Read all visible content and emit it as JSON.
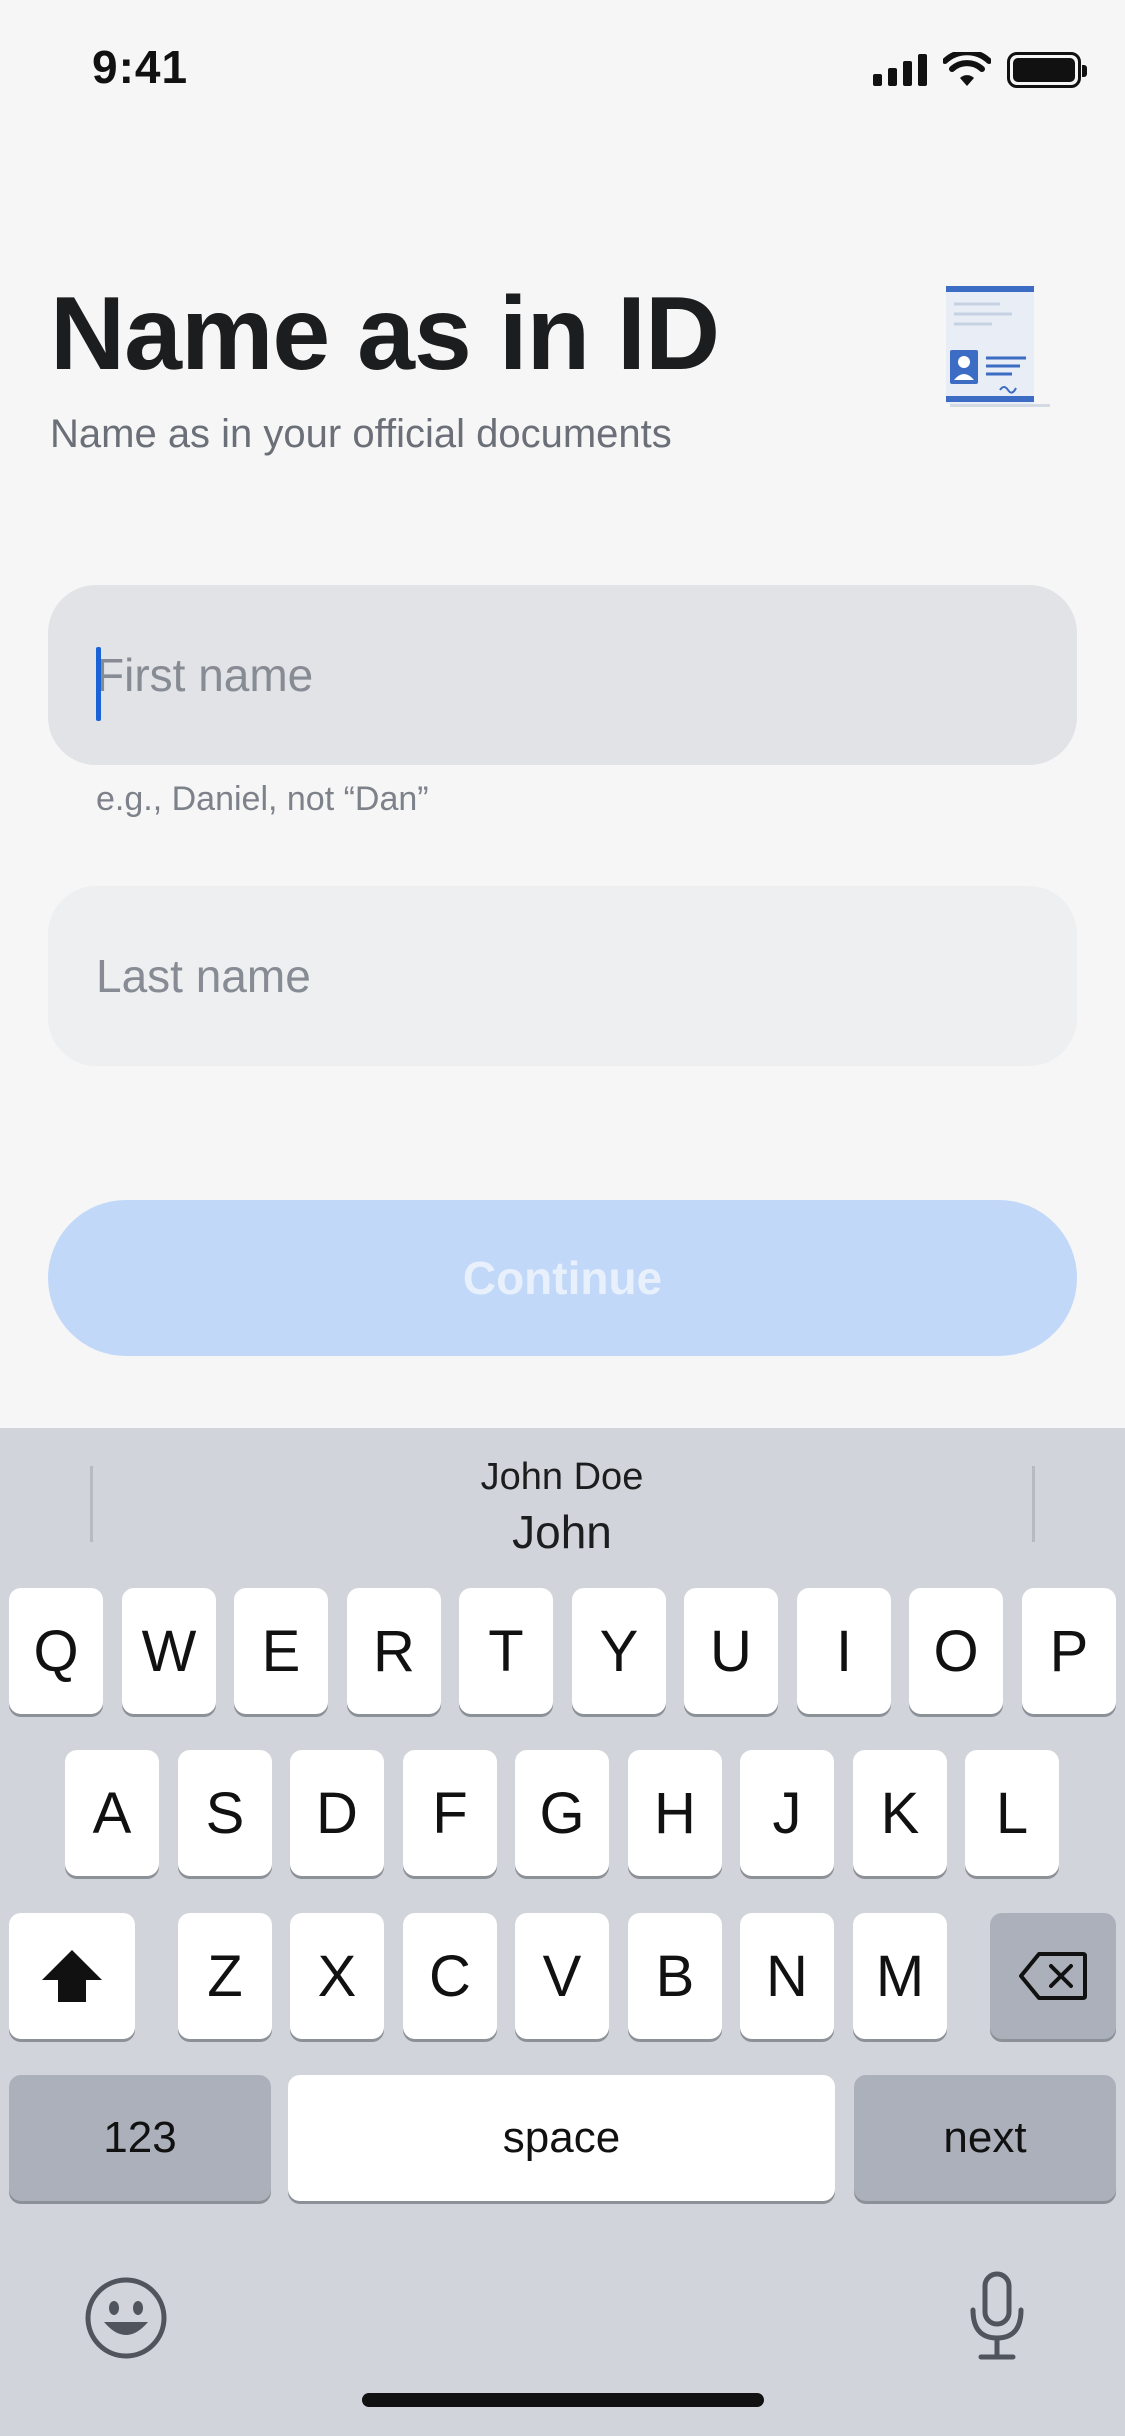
{
  "status_bar": {
    "time": "9:41"
  },
  "header": {
    "title": "Name as in ID",
    "subtitle": "Name as in your official documents"
  },
  "form": {
    "first_name": {
      "value": "",
      "placeholder": "First name",
      "hint": "e.g., Daniel, not “Dan”"
    },
    "last_name": {
      "value": "",
      "placeholder": "Last name"
    },
    "continue_label": "Continue"
  },
  "keyboard": {
    "suggestion_secondary": "John Doe",
    "suggestion_primary": "John",
    "rows": [
      [
        "Q",
        "W",
        "E",
        "R",
        "T",
        "Y",
        "U",
        "I",
        "O",
        "P"
      ],
      [
        "A",
        "S",
        "D",
        "F",
        "G",
        "H",
        "J",
        "K",
        "L"
      ],
      [
        "Z",
        "X",
        "C",
        "V",
        "B",
        "N",
        "M"
      ]
    ],
    "numbers_label": "123",
    "space_label": "space",
    "return_label": "next"
  },
  "colors": {
    "accent": "#1a63d6",
    "button_disabled": "#c1d8f8",
    "keyboard_bg": "#d1d4da"
  },
  "icons": {
    "shift": "shift-arrow-icon",
    "delete": "backspace-icon",
    "emoji": "emoji-icon",
    "dictation": "microphone-icon"
  }
}
